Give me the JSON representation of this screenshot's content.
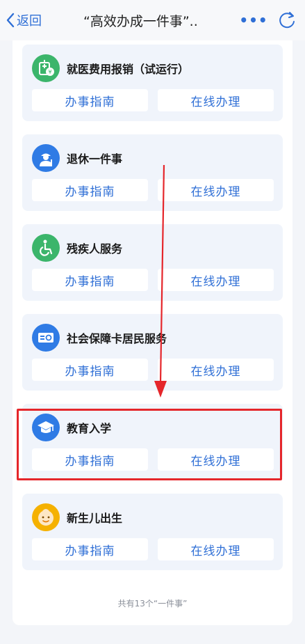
{
  "nav": {
    "back_label": "返回",
    "title": "“高效办成一件事”..",
    "more_label": "•••"
  },
  "services": [
    {
      "title": "就医费用报销（试运行）",
      "icon": "medical-reimbursement-icon",
      "color": "#3bb56b"
    },
    {
      "title": "退休一件事",
      "icon": "retiree-icon",
      "color": "#2f7be5"
    },
    {
      "title": "残疾人服务",
      "icon": "wheelchair-icon",
      "color": "#3bb56b"
    },
    {
      "title": "社会保障卡居民服务",
      "icon": "social-security-card-icon",
      "color": "#2f7be5"
    },
    {
      "title": "教育入学",
      "icon": "graduation-cap-icon",
      "color": "#2f7be5"
    },
    {
      "title": "新生儿出生",
      "icon": "baby-face-icon",
      "color": "#f5b100"
    }
  ],
  "buttons": {
    "guide_label": "办事指南",
    "online_label": "在线办理"
  },
  "footer": {
    "count_text": "共有13个“一件事”"
  },
  "colors": {
    "accent": "#2f6fd6",
    "highlight": "#e5262b",
    "card_bg": "#f0f4fb"
  }
}
